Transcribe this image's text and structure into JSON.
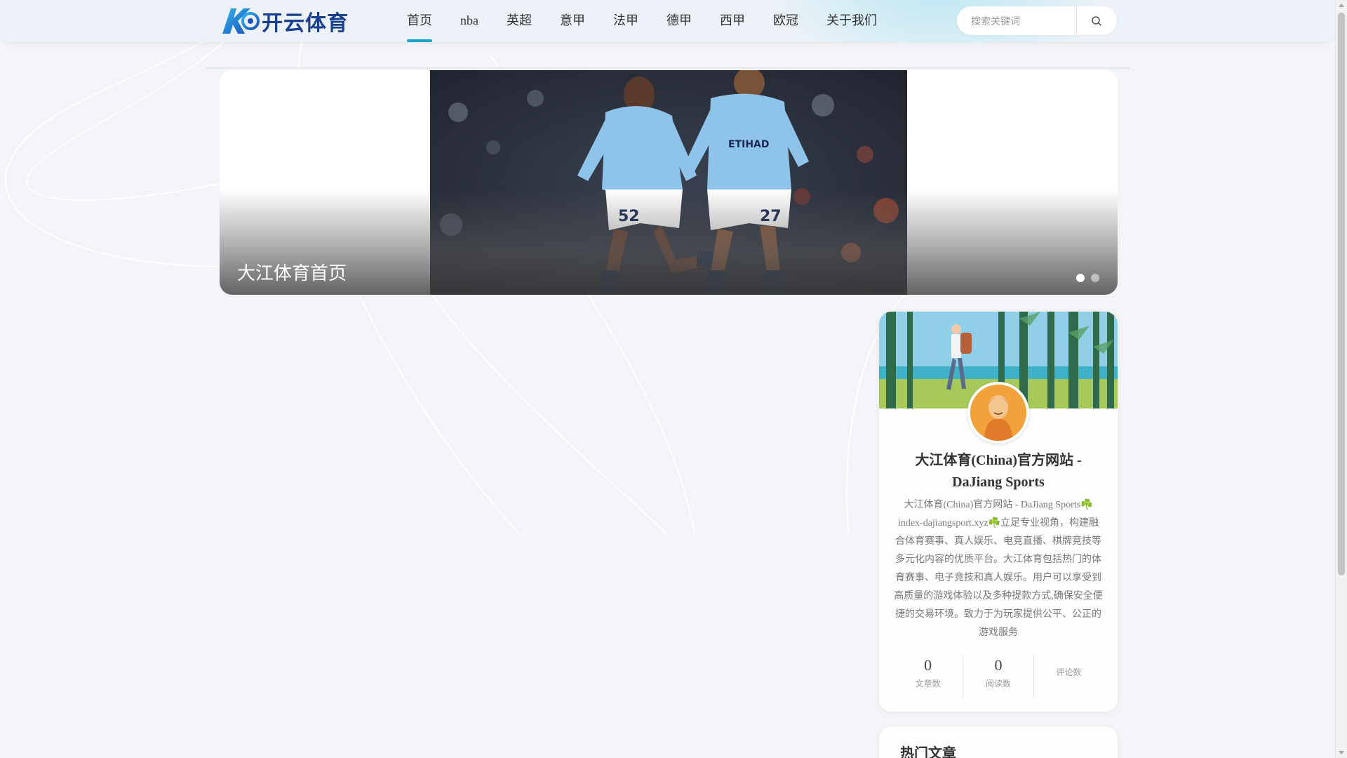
{
  "header": {
    "logo_text": "开云体育",
    "nav": [
      {
        "label": "首页",
        "active": true
      },
      {
        "label": "nba",
        "active": false
      },
      {
        "label": "英超",
        "active": false
      },
      {
        "label": "意甲",
        "active": false
      },
      {
        "label": "法甲",
        "active": false
      },
      {
        "label": "德甲",
        "active": false
      },
      {
        "label": "西甲",
        "active": false
      },
      {
        "label": "欧冠",
        "active": false
      },
      {
        "label": "关于我们",
        "active": false
      }
    ],
    "search": {
      "placeholder": "搜索关键词",
      "value": ""
    }
  },
  "banner": {
    "caption": "大江体育首页",
    "slide_count": 2,
    "active_slide": 1
  },
  "profile": {
    "name": "大江体育(China)官方网站 - DaJiang Sports",
    "description": "大江体育(China)官方网站 - DaJiang Sports☘️index-dajiangsport.xyz☘️立足专业视角，构建融合体育赛事、真人娱乐、电竞直播、棋牌竞技等多元化内容的优质平台。大江体育包括热门的体育赛事、电子竞技和真人娱乐。用户可以享受到高质量的游戏体验以及多种提款方式,确保安全便捷的交易环境。致力于为玩家提供公平、公正的游戏服务",
    "stats": {
      "articles": {
        "value": "0",
        "label": "文章数"
      },
      "reads": {
        "value": "0",
        "label": "阅读数"
      },
      "comments": {
        "label": "评论数"
      }
    }
  },
  "hot_articles": {
    "title": "热门文章"
  },
  "colors": {
    "accent": "#1aa6c9",
    "brand": "#1b3f8f",
    "background": "#f2f4f7"
  }
}
